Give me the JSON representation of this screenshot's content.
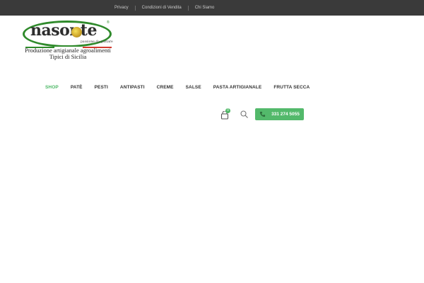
{
  "topbar": {
    "links": [
      "Privacy",
      "Condizioni di Vendita",
      "Chi Siamo"
    ]
  },
  "logo": {
    "brand": "nasonte",
    "tagline": "passione da gustare",
    "registered": "®",
    "subtitle_line1": "Produzione artigianale agroalimenti",
    "subtitle_line2": "Tipici di Sicilia"
  },
  "nav": {
    "items": [
      "SHOP",
      "PATÈ",
      "PESTI",
      "ANTIPASTI",
      "CREME",
      "SALSE",
      "PASTA ARTIGIANALE",
      "FRUTTA SECCA"
    ],
    "active_index": 0
  },
  "header_actions": {
    "cart_icon": "cart-icon",
    "cart_count": "0",
    "search_icon": "search-icon",
    "phone_icon": "phone-icon",
    "phone_number": "331 274 5055"
  },
  "colors": {
    "accent": "#53b96b",
    "topbar": "#3a3a3a",
    "logo_green": "#2f8a2b"
  }
}
